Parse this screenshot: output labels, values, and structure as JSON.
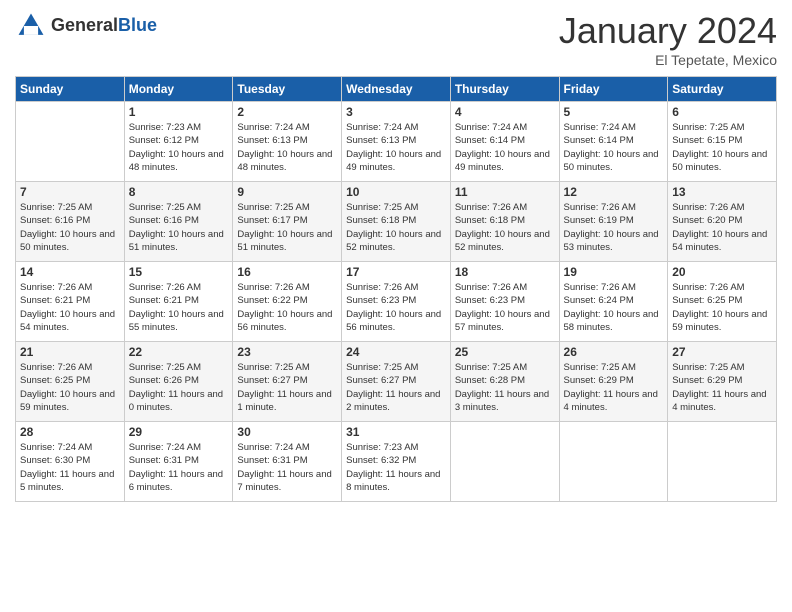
{
  "header": {
    "logo_general": "General",
    "logo_blue": "Blue",
    "month_title": "January 2024",
    "location": "El Tepetate, Mexico"
  },
  "days_of_week": [
    "Sunday",
    "Monday",
    "Tuesday",
    "Wednesday",
    "Thursday",
    "Friday",
    "Saturday"
  ],
  "weeks": [
    [
      {
        "day": "",
        "sunrise": "",
        "sunset": "",
        "daylight": ""
      },
      {
        "day": "1",
        "sunrise": "Sunrise: 7:23 AM",
        "sunset": "Sunset: 6:12 PM",
        "daylight": "Daylight: 10 hours and 48 minutes."
      },
      {
        "day": "2",
        "sunrise": "Sunrise: 7:24 AM",
        "sunset": "Sunset: 6:13 PM",
        "daylight": "Daylight: 10 hours and 48 minutes."
      },
      {
        "day": "3",
        "sunrise": "Sunrise: 7:24 AM",
        "sunset": "Sunset: 6:13 PM",
        "daylight": "Daylight: 10 hours and 49 minutes."
      },
      {
        "day": "4",
        "sunrise": "Sunrise: 7:24 AM",
        "sunset": "Sunset: 6:14 PM",
        "daylight": "Daylight: 10 hours and 49 minutes."
      },
      {
        "day": "5",
        "sunrise": "Sunrise: 7:24 AM",
        "sunset": "Sunset: 6:14 PM",
        "daylight": "Daylight: 10 hours and 50 minutes."
      },
      {
        "day": "6",
        "sunrise": "Sunrise: 7:25 AM",
        "sunset": "Sunset: 6:15 PM",
        "daylight": "Daylight: 10 hours and 50 minutes."
      }
    ],
    [
      {
        "day": "7",
        "sunrise": "Sunrise: 7:25 AM",
        "sunset": "Sunset: 6:16 PM",
        "daylight": "Daylight: 10 hours and 50 minutes."
      },
      {
        "day": "8",
        "sunrise": "Sunrise: 7:25 AM",
        "sunset": "Sunset: 6:16 PM",
        "daylight": "Daylight: 10 hours and 51 minutes."
      },
      {
        "day": "9",
        "sunrise": "Sunrise: 7:25 AM",
        "sunset": "Sunset: 6:17 PM",
        "daylight": "Daylight: 10 hours and 51 minutes."
      },
      {
        "day": "10",
        "sunrise": "Sunrise: 7:25 AM",
        "sunset": "Sunset: 6:18 PM",
        "daylight": "Daylight: 10 hours and 52 minutes."
      },
      {
        "day": "11",
        "sunrise": "Sunrise: 7:26 AM",
        "sunset": "Sunset: 6:18 PM",
        "daylight": "Daylight: 10 hours and 52 minutes."
      },
      {
        "day": "12",
        "sunrise": "Sunrise: 7:26 AM",
        "sunset": "Sunset: 6:19 PM",
        "daylight": "Daylight: 10 hours and 53 minutes."
      },
      {
        "day": "13",
        "sunrise": "Sunrise: 7:26 AM",
        "sunset": "Sunset: 6:20 PM",
        "daylight": "Daylight: 10 hours and 54 minutes."
      }
    ],
    [
      {
        "day": "14",
        "sunrise": "Sunrise: 7:26 AM",
        "sunset": "Sunset: 6:21 PM",
        "daylight": "Daylight: 10 hours and 54 minutes."
      },
      {
        "day": "15",
        "sunrise": "Sunrise: 7:26 AM",
        "sunset": "Sunset: 6:21 PM",
        "daylight": "Daylight: 10 hours and 55 minutes."
      },
      {
        "day": "16",
        "sunrise": "Sunrise: 7:26 AM",
        "sunset": "Sunset: 6:22 PM",
        "daylight": "Daylight: 10 hours and 56 minutes."
      },
      {
        "day": "17",
        "sunrise": "Sunrise: 7:26 AM",
        "sunset": "Sunset: 6:23 PM",
        "daylight": "Daylight: 10 hours and 56 minutes."
      },
      {
        "day": "18",
        "sunrise": "Sunrise: 7:26 AM",
        "sunset": "Sunset: 6:23 PM",
        "daylight": "Daylight: 10 hours and 57 minutes."
      },
      {
        "day": "19",
        "sunrise": "Sunrise: 7:26 AM",
        "sunset": "Sunset: 6:24 PM",
        "daylight": "Daylight: 10 hours and 58 minutes."
      },
      {
        "day": "20",
        "sunrise": "Sunrise: 7:26 AM",
        "sunset": "Sunset: 6:25 PM",
        "daylight": "Daylight: 10 hours and 59 minutes."
      }
    ],
    [
      {
        "day": "21",
        "sunrise": "Sunrise: 7:26 AM",
        "sunset": "Sunset: 6:25 PM",
        "daylight": "Daylight: 10 hours and 59 minutes."
      },
      {
        "day": "22",
        "sunrise": "Sunrise: 7:25 AM",
        "sunset": "Sunset: 6:26 PM",
        "daylight": "Daylight: 11 hours and 0 minutes."
      },
      {
        "day": "23",
        "sunrise": "Sunrise: 7:25 AM",
        "sunset": "Sunset: 6:27 PM",
        "daylight": "Daylight: 11 hours and 1 minute."
      },
      {
        "day": "24",
        "sunrise": "Sunrise: 7:25 AM",
        "sunset": "Sunset: 6:27 PM",
        "daylight": "Daylight: 11 hours and 2 minutes."
      },
      {
        "day": "25",
        "sunrise": "Sunrise: 7:25 AM",
        "sunset": "Sunset: 6:28 PM",
        "daylight": "Daylight: 11 hours and 3 minutes."
      },
      {
        "day": "26",
        "sunrise": "Sunrise: 7:25 AM",
        "sunset": "Sunset: 6:29 PM",
        "daylight": "Daylight: 11 hours and 4 minutes."
      },
      {
        "day": "27",
        "sunrise": "Sunrise: 7:25 AM",
        "sunset": "Sunset: 6:29 PM",
        "daylight": "Daylight: 11 hours and 4 minutes."
      }
    ],
    [
      {
        "day": "28",
        "sunrise": "Sunrise: 7:24 AM",
        "sunset": "Sunset: 6:30 PM",
        "daylight": "Daylight: 11 hours and 5 minutes."
      },
      {
        "day": "29",
        "sunrise": "Sunrise: 7:24 AM",
        "sunset": "Sunset: 6:31 PM",
        "daylight": "Daylight: 11 hours and 6 minutes."
      },
      {
        "day": "30",
        "sunrise": "Sunrise: 7:24 AM",
        "sunset": "Sunset: 6:31 PM",
        "daylight": "Daylight: 11 hours and 7 minutes."
      },
      {
        "day": "31",
        "sunrise": "Sunrise: 7:23 AM",
        "sunset": "Sunset: 6:32 PM",
        "daylight": "Daylight: 11 hours and 8 minutes."
      },
      {
        "day": "",
        "sunrise": "",
        "sunset": "",
        "daylight": ""
      },
      {
        "day": "",
        "sunrise": "",
        "sunset": "",
        "daylight": ""
      },
      {
        "day": "",
        "sunrise": "",
        "sunset": "",
        "daylight": ""
      }
    ]
  ]
}
